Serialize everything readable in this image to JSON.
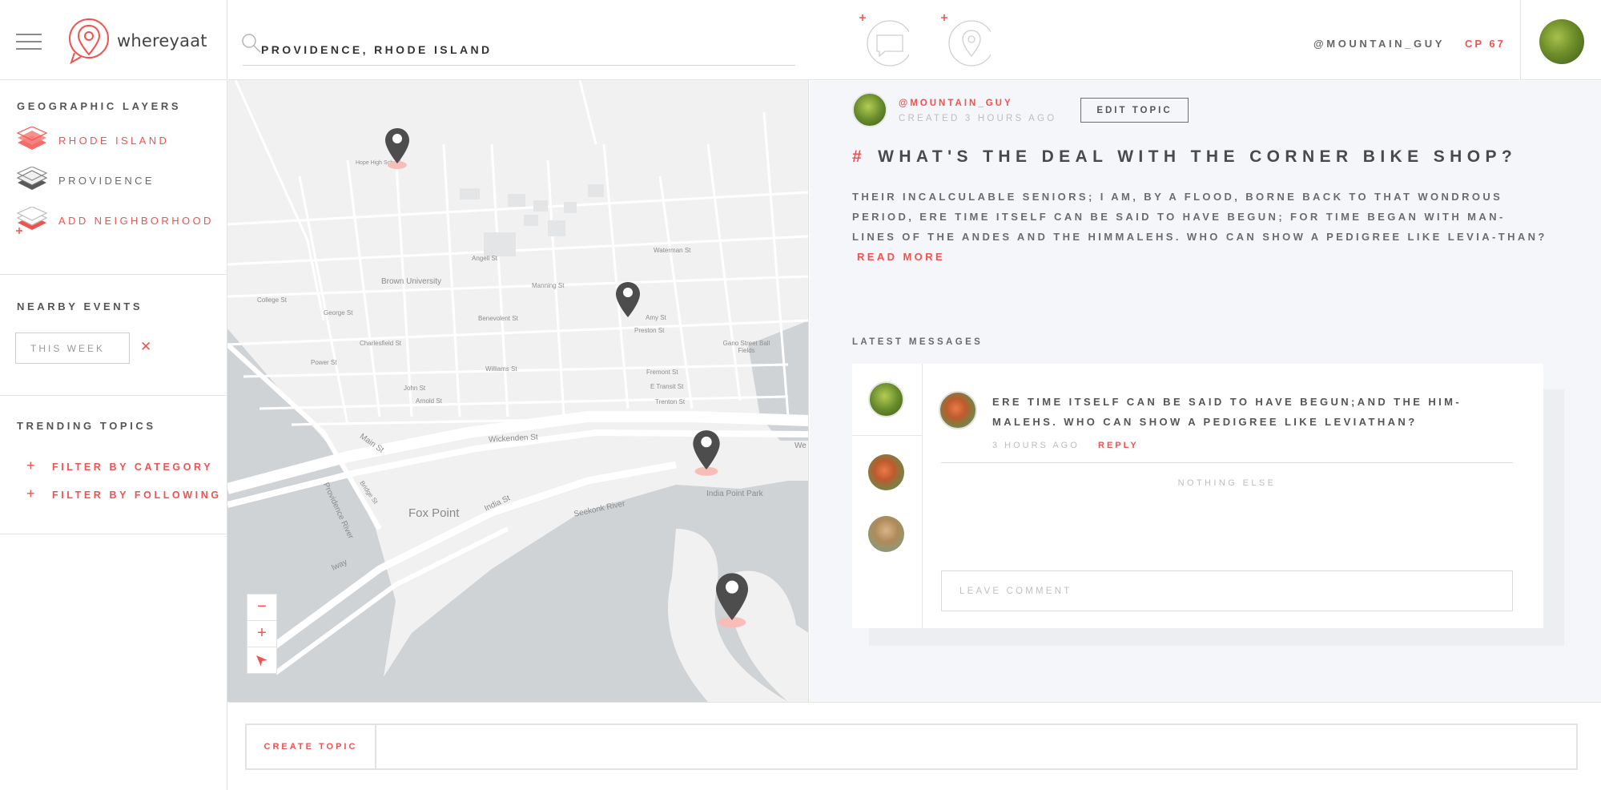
{
  "app": {
    "logo_text": "whereyaat"
  },
  "search": {
    "value": "PROVIDENCE, RHODE ISLAND"
  },
  "sidebar": {
    "geo_heading": "GEOGRAPHIC LAYERS",
    "layers": [
      {
        "label": "RHODE ISLAND",
        "active": true
      },
      {
        "label": "PROVIDENCE",
        "active": false
      },
      {
        "label": "ADD NEIGHBORHOOD",
        "active": false
      }
    ],
    "events_heading": "NEARBY EVENTS",
    "events_filter": "THIS WEEK",
    "events_clear": "✕",
    "trending_heading": "TRENDING TOPICS",
    "filters": [
      {
        "label": "FILTER BY CATEGORY"
      },
      {
        "label": "FILTER BY FOLLOWING"
      }
    ]
  },
  "map": {
    "labels": {
      "brown": "Brown University",
      "fox_point": "Fox Point",
      "india_point": "India Point Park",
      "gano": "Gano Street Ball Fields",
      "seekonk": "Seekonk River",
      "providence_river": "Providence River",
      "wickenden": "Wickenden St",
      "india_st": "India St",
      "main_st": "Main St",
      "bridge_st": "Bridge St",
      "williams": "Williams St",
      "john": "John St",
      "arnold": "Arnold St",
      "charlesfield": "Charlesfield St",
      "power": "Power St",
      "george": "George St",
      "college": "College St",
      "angell": "Angell St",
      "manning": "Manning St",
      "benevolent": "Benevolent St",
      "amy": "Amy St",
      "preston": "Preston St",
      "fremont": "Fremont St",
      "transit": "E Transit St",
      "trenton": "Trenton St",
      "waterman": "Waterman St",
      "hope_high": "Hope High School",
      "way": "lway",
      "we": "We"
    },
    "zoom_out": "−",
    "zoom_in": "+"
  },
  "header": {
    "username": "@MOUNTAIN_GUY",
    "cp": "CP 67"
  },
  "topic": {
    "author": "@MOUNTAIN_GUY",
    "created": "CREATED 3 HOURS AGO",
    "edit_label": "EDIT TOPIC",
    "hash": "#",
    "title": "WHAT'S THE DEAL WITH THE CORNER BIKE SHOP?",
    "body": "THEIR INCALCULABLE SENIORS; I AM, BY A FLOOD, BORNE BACK TO THAT WONDROUS PERIOD, ERE TIME ITSELF CAN BE SAID TO HAVE BEGUN; FOR TIME BEGAN WITH MAN-LINES OF THE ANDES AND THE HIMMALEHS. WHO CAN SHOW A PEDIGREE LIKE LEVIA-THAN?",
    "read_more": "READ MORE"
  },
  "messages": {
    "heading": "LATEST MESSAGES",
    "items": [
      {
        "text": "ERE TIME ITSELF CAN BE SAID TO HAVE BEGUN;AND THE HIM-MALEHS. WHO CAN SHOW A PEDIGREE LIKE LEVIATHAN?",
        "time": "3 HOURS AGO",
        "reply": "REPLY"
      }
    ],
    "nothing_else": "NOTHING ELSE",
    "comment_placeholder": "LEAVE COMMENT"
  },
  "bottom": {
    "create_label": "CREATE TOPIC"
  },
  "colors": {
    "accent": "#f0524f",
    "water": "#cfd3d6",
    "land": "#f1f1f1",
    "pin": "#4d4d4d"
  }
}
